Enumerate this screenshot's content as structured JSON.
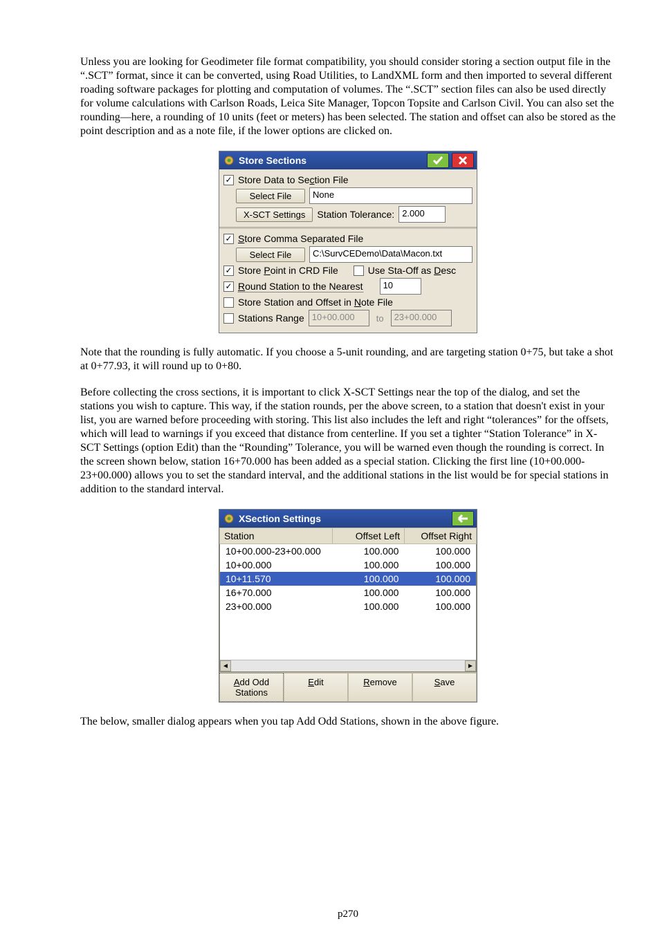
{
  "paragraphs": {
    "p1": "Unless you are looking for Geodimeter file format compatibility, you should consider storing a section output file in the “.SCT” format, since it can be converted, using Road Utilities, to LandXML form and then imported to several different roading software packages for plotting and computation of volumes. The “.SCT” section files can also be used directly for volume calculations with Carlson Roads, Leica Site Manager, Topcon Topsite and Carlson Civil. You can also set the rounding—here, a rounding of 10 units (feet or meters) has been selected.  The station and offset can also be stored as the point description and as a note file, if the lower options are clicked on.",
    "p2": "Note that the rounding is fully automatic. If you choose a 5-unit rounding, and are targeting station 0+75, but take a shot at 0+77.93, it will round up to 0+80.",
    "p3": "Before collecting the cross sections, it is important to click X-SCT Settings near the top of the dialog, and set the stations you wish to capture.  This way, if the station rounds, per the above screen, to a station that doesn't exist in your list, you are warned before proceeding with storing.  This list also includes the left and right “tolerances” for the offsets, which will lead to warnings if you exceed that distance from centerline.  If you set a tighter “Station Tolerance” in X-SCT Settings (option Edit) than the “Rounding” Tolerance, you will be warned even though the rounding is correct.  In the screen shown below, station 16+70.000 has been added as a special station.  Clicking the first line (10+00.000-23+00.000) allows you to set the standard interval, and the additional stations in the list would be for special stations in addition to the standard interval.",
    "p4": "The below, smaller dialog appears when you tap Add Odd Stations, shown in the above figure."
  },
  "dialog1": {
    "title": "Store Sections",
    "store_section_label": "Store Data to Se",
    "store_section_label2": "tion File",
    "select_file": "Select File",
    "file1": "None",
    "xsct_btn": "X-SCT Settings",
    "station_tol_label": "Station Tolerance:",
    "station_tol_value": "2.000",
    "store_csv_pre": "S",
    "store_csv_label": "tore Comma Separated File",
    "file2": "C:\\SurvCEDemo\\Data\\Macon.txt",
    "store_point_pre": "Store ",
    "store_point_u": "P",
    "store_point_post": "oint in CRD File",
    "use_staoff_pre": "Use Sta-Off as ",
    "use_staoff_u": "D",
    "use_staoff_post": "esc",
    "round_u": "R",
    "round_label": "ound Station to the Nearest",
    "round_value": "10",
    "store_note_pre": "Store Station and Offset in ",
    "store_note_u": "N",
    "store_note_post": "ote File",
    "stations_range": "Stations Range",
    "range_from": "10+00.000",
    "range_to_lbl": "to",
    "range_to": "23+00.000"
  },
  "dialog2": {
    "title": "XSection Settings",
    "col_station": "Station",
    "col_left": "Offset Left",
    "col_right": "Offset Right",
    "rows": [
      {
        "s": "10+00.000-23+00.000",
        "l": "100.000",
        "r": "100.000",
        "sel": false
      },
      {
        "s": "10+00.000",
        "l": "100.000",
        "r": "100.000",
        "sel": false
      },
      {
        "s": "10+11.570",
        "l": "100.000",
        "r": "100.000",
        "sel": true
      },
      {
        "s": "16+70.000",
        "l": "100.000",
        "r": "100.000",
        "sel": false
      },
      {
        "s": "23+00.000",
        "l": "100.000",
        "r": "100.000",
        "sel": false
      }
    ],
    "btn_add_u": "A",
    "btn_add": "dd Odd Stations",
    "btn_edit_u": "E",
    "btn_edit": "dit",
    "btn_remove_u": "R",
    "btn_remove": "emove",
    "btn_save_u": "S",
    "btn_save": "ave"
  },
  "footer": "p270"
}
